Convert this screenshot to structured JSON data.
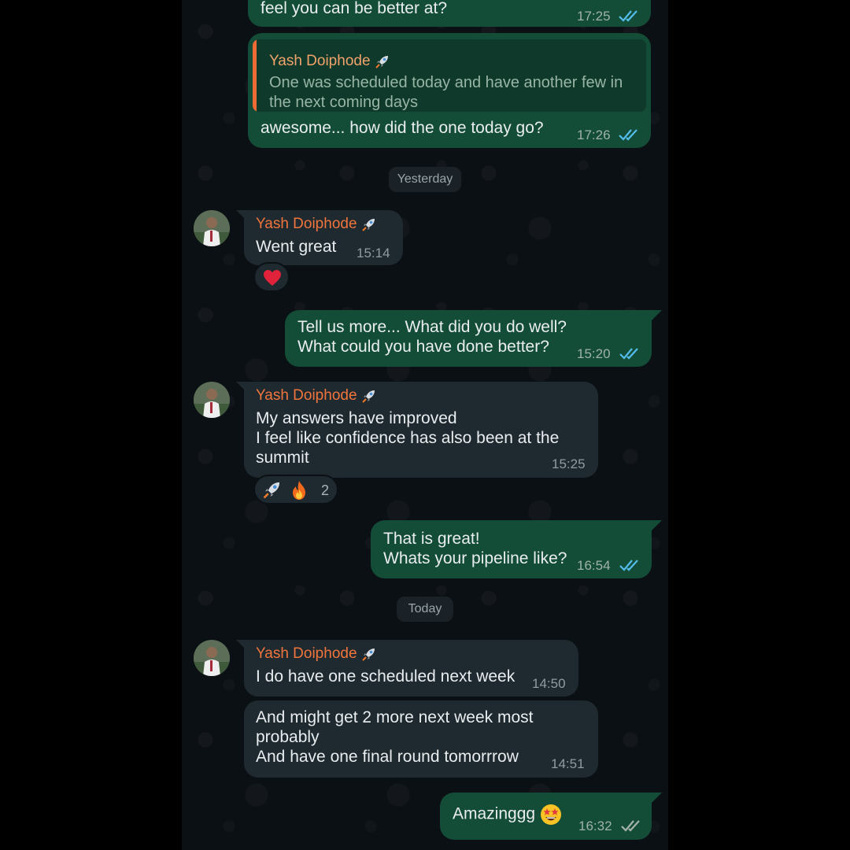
{
  "conversation": {
    "contact_name": "Yash Doiphode",
    "contact_badge_icon": "rocket-icon",
    "tick_color_read": "#53bdeb",
    "tick_color_delivered": "#a6b3ab"
  },
  "messages": {
    "m0": {
      "text": "feel you can be better at?",
      "time": "17:25"
    },
    "m1": {
      "quote_sender": "Yash Doiphode",
      "quote_text": "One was scheduled today and have another few in the next coming days",
      "text": "awesome... how did the one today go?",
      "time": "17:26"
    },
    "date1": "Yesterday",
    "m2": {
      "sender": "Yash Doiphode",
      "text": "Went great",
      "time": "15:14",
      "reaction": "red-heart-icon"
    },
    "m3": {
      "line1": "Tell us more... What did you do well?",
      "line2": "What could you have done better?",
      "time": "15:20"
    },
    "m4": {
      "sender": "Yash Doiphode",
      "line1": "My answers have improved",
      "line2": "I feel like confidence has also been at the",
      "line3": "summit",
      "time": "15:25",
      "reactions": [
        "rocket-icon",
        "fire-icon"
      ],
      "reaction_count": "2"
    },
    "m5": {
      "line1": "That is great!",
      "line2": "Whats your pipeline like?",
      "time": "16:54"
    },
    "date2": "Today",
    "m6": {
      "sender": "Yash Doiphode",
      "text": "I do have one scheduled next week",
      "time": "14:50"
    },
    "m7": {
      "line1": "And might get 2 more next week most",
      "line2": "probably",
      "line3": "And have one final round tomorrrow",
      "time": "14:51"
    },
    "m8": {
      "text": "Amazinggg",
      "emoji": "star-struck-icon",
      "time": "16:32"
    }
  }
}
